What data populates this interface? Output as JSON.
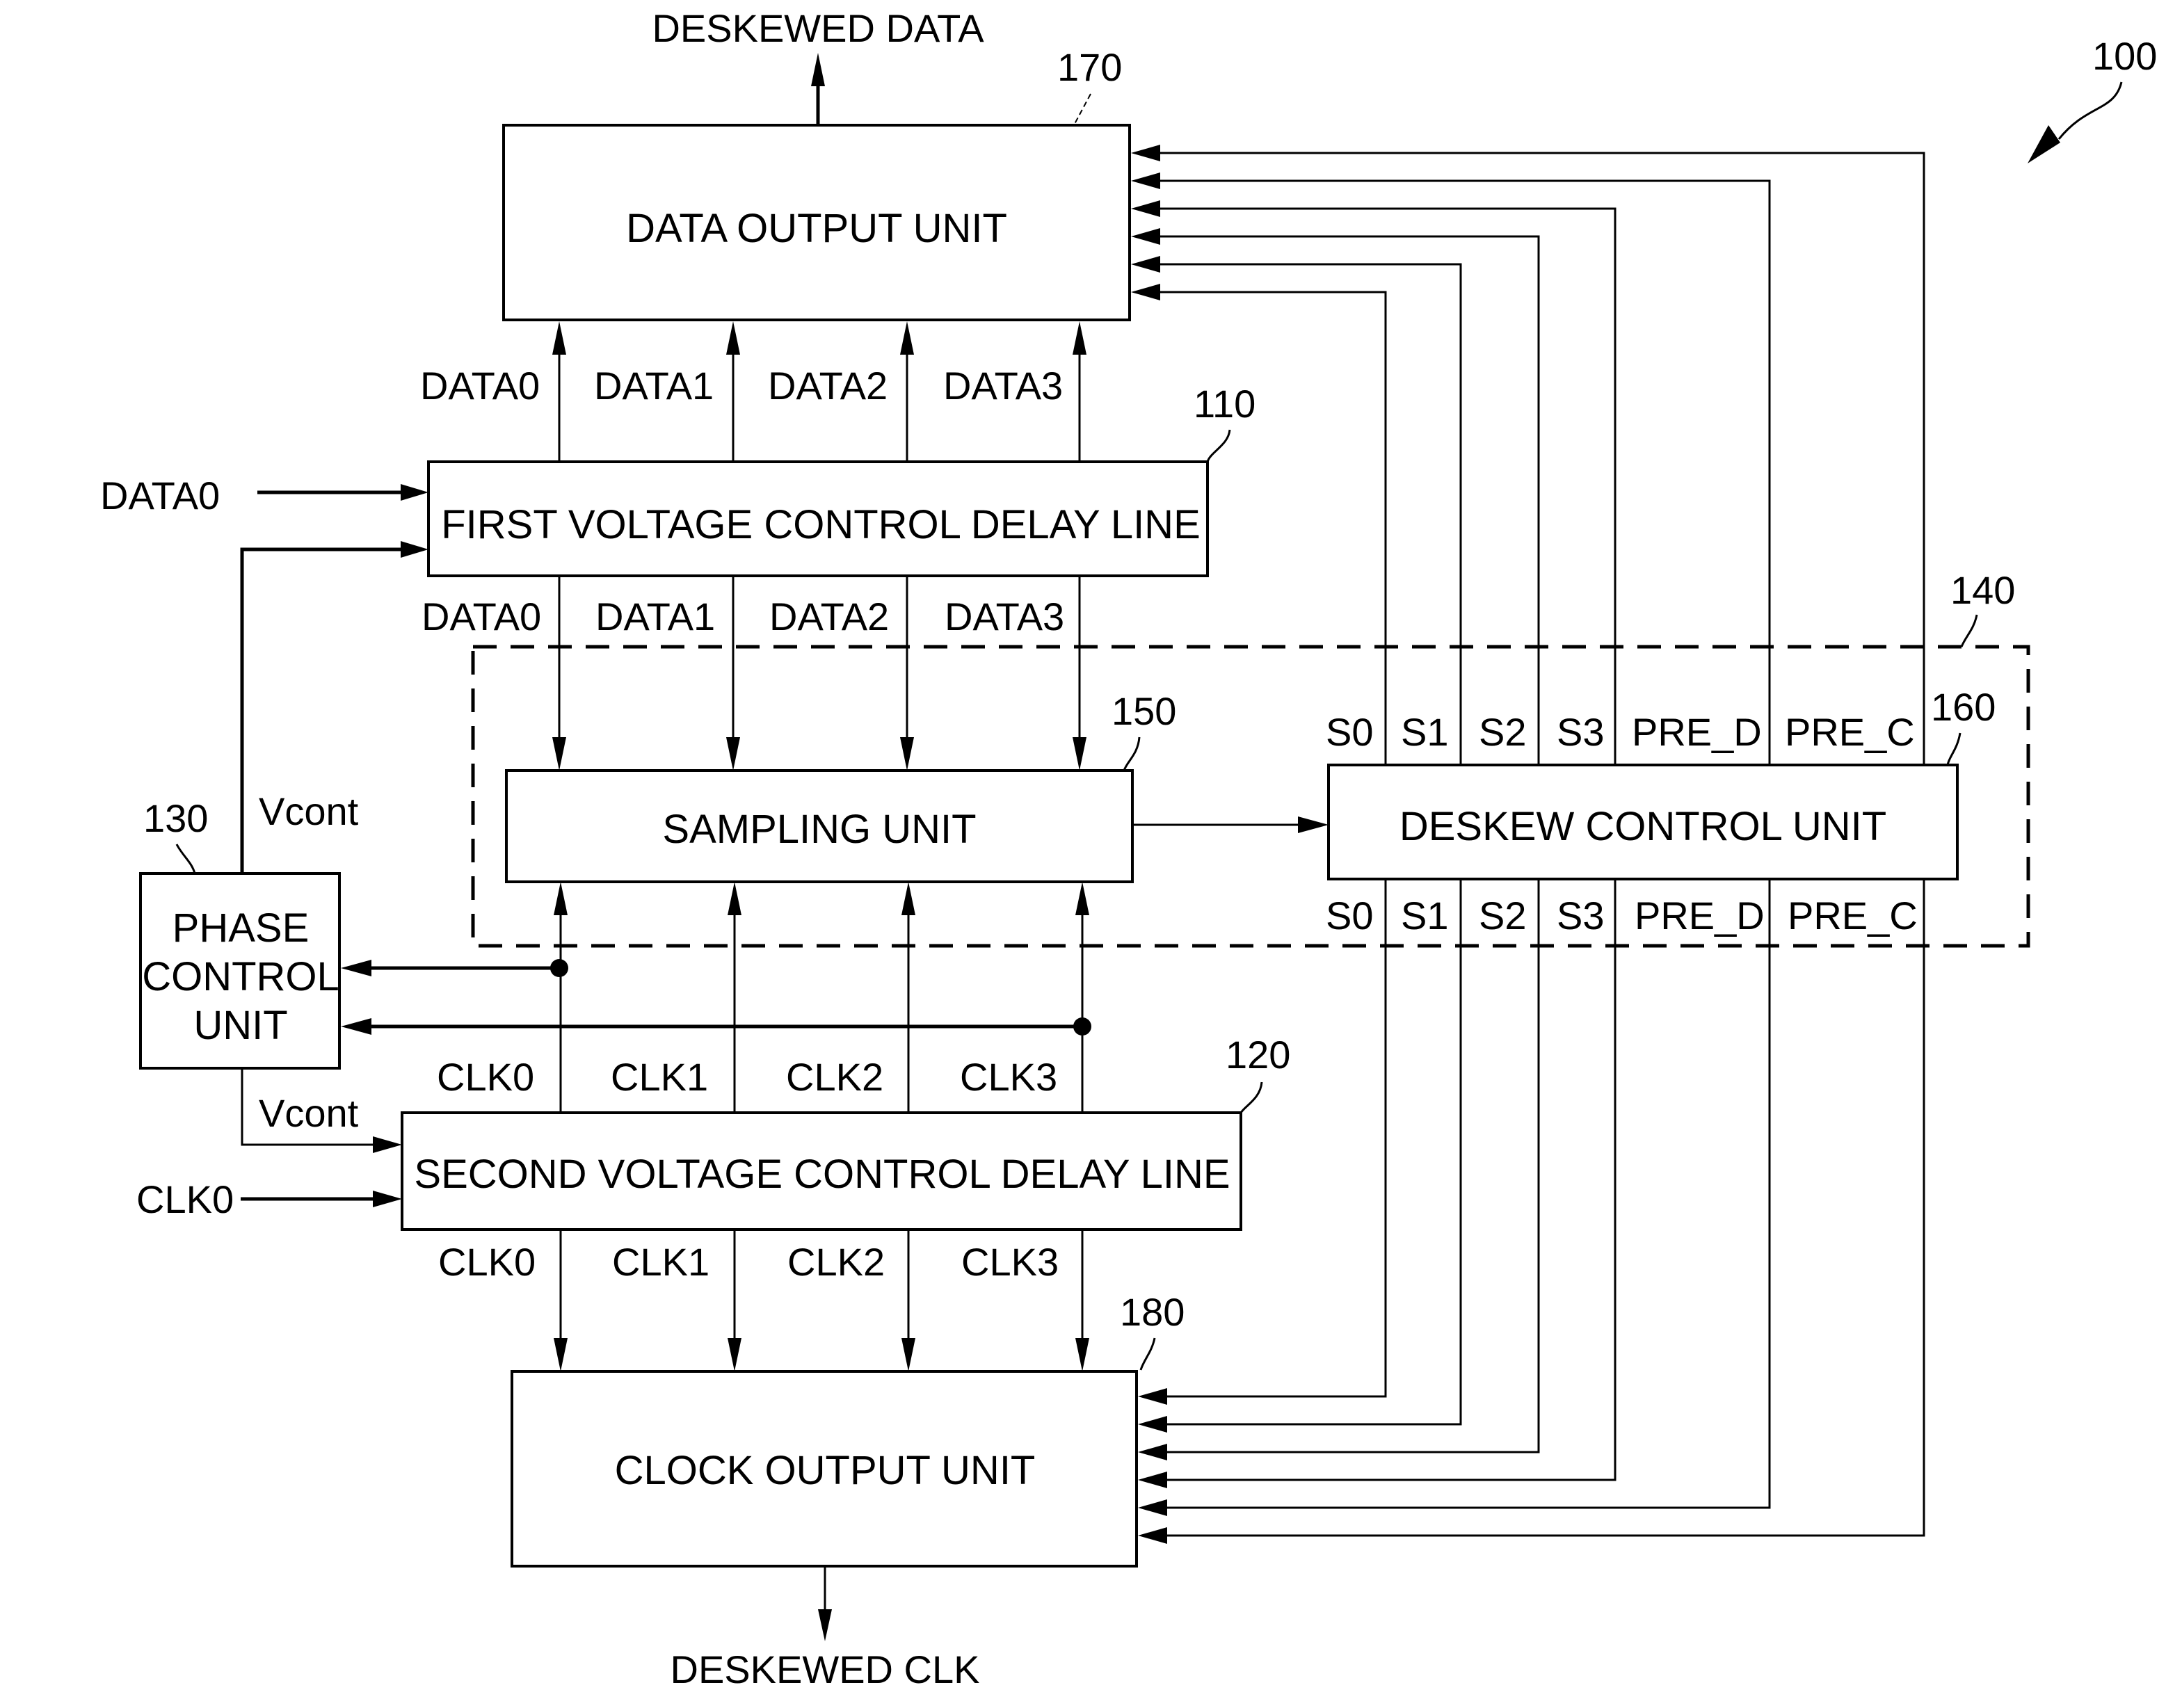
{
  "figure": {
    "ref": "100",
    "outputs": {
      "deskewed_data": "DESKEWED DATA",
      "deskewed_clk": "DESKEWED CLK"
    },
    "blocks": {
      "data_output_unit": {
        "label": "DATA OUTPUT UNIT",
        "ref": "170"
      },
      "first_vcdl": {
        "label": "FIRST VOLTAGE CONTROL DELAY LINE",
        "ref": "110"
      },
      "second_vcdl": {
        "label": "SECOND VOLTAGE CONTROL DELAY LINE",
        "ref": "120"
      },
      "phase_control_unit": {
        "lines": [
          "PHASE",
          "CONTROL",
          "UNIT"
        ],
        "ref": "130"
      },
      "deskew_group": {
        "ref": "140"
      },
      "sampling_unit": {
        "label": "SAMPLING UNIT",
        "ref": "150"
      },
      "deskew_control_unit": {
        "label": "DESKEW CONTROL UNIT",
        "ref": "160"
      },
      "clock_output_unit": {
        "label": "CLOCK OUTPUT UNIT",
        "ref": "180"
      }
    },
    "inputs": {
      "data_in": "DATA0",
      "clk_in": "CLK0"
    },
    "vcont_labels": [
      "Vcont",
      "Vcont"
    ],
    "data_signals": [
      "DATA0",
      "DATA1",
      "DATA2",
      "DATA3"
    ],
    "clk_signals": [
      "CLK0",
      "CLK1",
      "CLK2",
      "CLK3"
    ],
    "control_signals": [
      "S0",
      "S1",
      "S2",
      "S3",
      "PRE_D",
      "PRE_C"
    ]
  }
}
